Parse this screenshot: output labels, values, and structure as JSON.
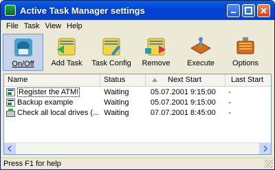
{
  "window": {
    "title": "Active Task Manager settings"
  },
  "menu": [
    "File",
    "Task",
    "View",
    "Help"
  ],
  "toolbar": [
    {
      "label": "On/Off",
      "icon": "power-icon",
      "pressed": true
    },
    {
      "label": "Add Task",
      "icon": "add-task-icon"
    },
    {
      "label": "Task Config",
      "icon": "task-config-icon"
    },
    {
      "label": "Remove",
      "icon": "remove-task-icon"
    },
    {
      "label": "Execute",
      "icon": "execute-icon"
    },
    {
      "label": "Options",
      "icon": "options-icon"
    }
  ],
  "list": {
    "columns": [
      "Name",
      "Status",
      "Next Start",
      "Last Start"
    ],
    "sorted_column": "Next Start",
    "rows": [
      {
        "name": "Register the ATM!",
        "status": "Waiting",
        "next": "05.07.2001 9:15:00",
        "last": "-"
      },
      {
        "name": "Backup example",
        "status": "Waiting",
        "next": "05.07.2001 9:15:00",
        "last": "-"
      },
      {
        "name": "Check all local drives (...",
        "status": "Waiting",
        "next": "07.07.2001 8:45:00",
        "last": "-"
      }
    ]
  },
  "status": {
    "text": "Press F1 for help"
  }
}
